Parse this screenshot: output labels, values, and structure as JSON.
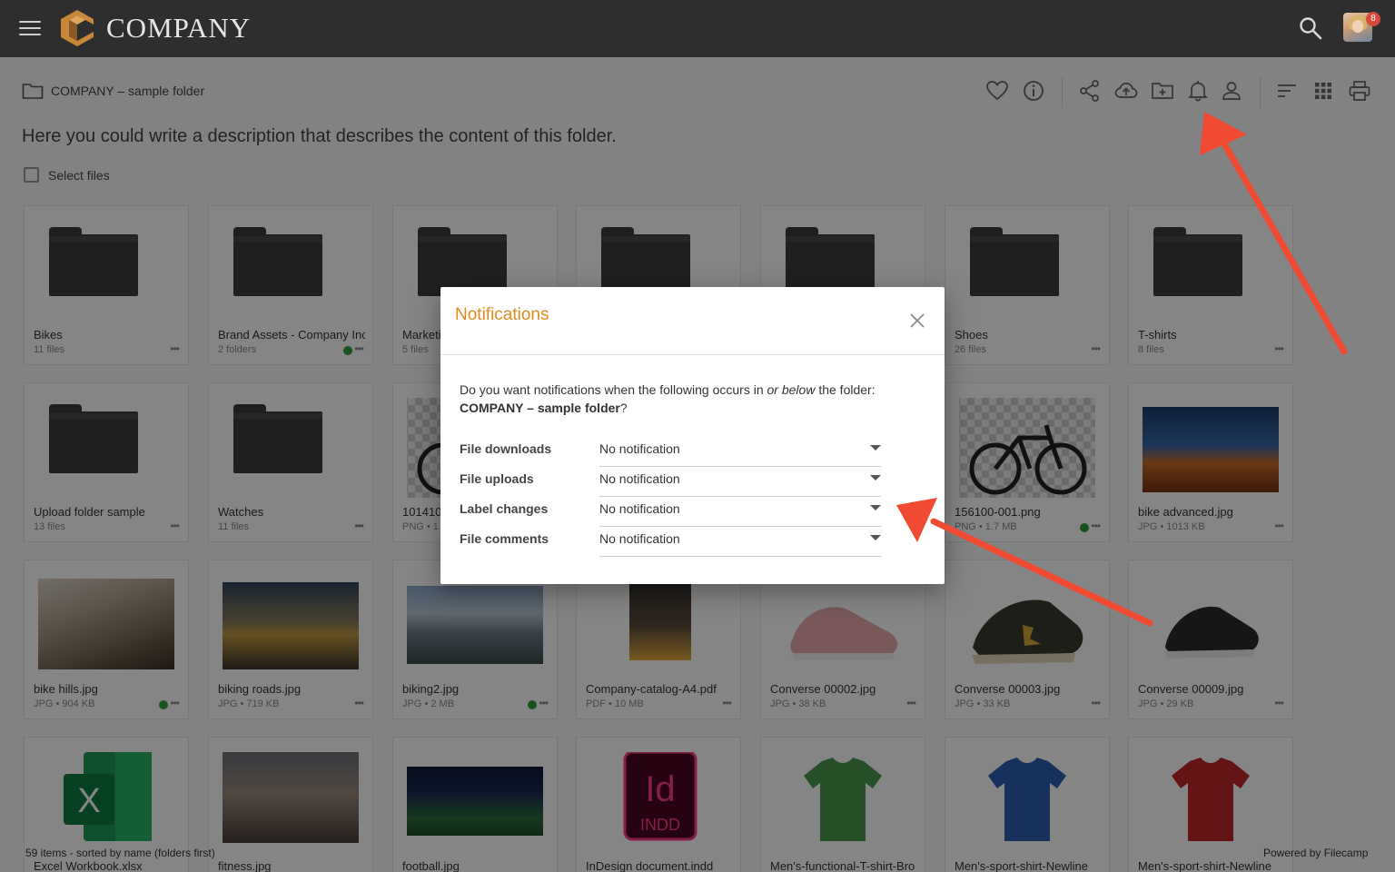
{
  "app": {
    "brand": "COMPANY",
    "notification_count": "8"
  },
  "breadcrumb": {
    "path": "COMPANY – sample folder"
  },
  "description": "Here you could write a description that describes the content of this folder.",
  "select_files_label": "Select files",
  "tiles": [
    {
      "name": "Bikes",
      "meta": "11 files",
      "kind": "folder",
      "dot": false
    },
    {
      "name": "Brand Assets - Company Inc",
      "meta": "2 folders",
      "kind": "folder",
      "dot": true
    },
    {
      "name": "Marketi",
      "meta": "5 files",
      "kind": "folder",
      "dot": false
    },
    {
      "name": "",
      "meta": "",
      "kind": "folder",
      "dot": false
    },
    {
      "name": "",
      "meta": "",
      "kind": "folder",
      "dot": false
    },
    {
      "name": "Shoes",
      "meta": "26 files",
      "kind": "folder",
      "dot": false
    },
    {
      "name": "T-shirts",
      "meta": "8 files",
      "kind": "folder",
      "dot": false
    },
    {
      "name": "Upload folder sample",
      "meta": "13 files",
      "kind": "folder",
      "dot": false
    },
    {
      "name": "Watches",
      "meta": "11 files",
      "kind": "folder",
      "dot": false
    },
    {
      "name": "101410",
      "meta": "PNG • 1",
      "kind": "bike-checker",
      "dot": false
    },
    {
      "name": "",
      "meta": "",
      "kind": "blank",
      "dot": false
    },
    {
      "name": "",
      "meta": "",
      "kind": "blank",
      "dot": false
    },
    {
      "name": "156100-001.png",
      "meta": "PNG • 1.7 MB",
      "kind": "bike-checker",
      "dot": true
    },
    {
      "name": "bike advanced.jpg",
      "meta": "JPG • 1013 KB",
      "kind": "photo-desert",
      "dot": false
    },
    {
      "name": "bike hills.jpg",
      "meta": "JPG • 904 KB",
      "kind": "photo-hills",
      "dot": true
    },
    {
      "name": "biking roads.jpg",
      "meta": "JPG • 719 KB",
      "kind": "photo-road",
      "dot": false
    },
    {
      "name": "biking2.jpg",
      "meta": "JPG • 2 MB",
      "kind": "photo-coast",
      "dot": true
    },
    {
      "name": "Company-catalog-A4.pdf",
      "meta": "PDF • 10 MB",
      "kind": "pdf",
      "dot": false
    },
    {
      "name": "Converse 00002.jpg",
      "meta": "JPG • 38 KB",
      "kind": "shoe-pink",
      "dot": false
    },
    {
      "name": "Converse 00003.jpg",
      "meta": "JPG • 33 KB",
      "kind": "shoe-dark",
      "dot": false
    },
    {
      "name": "Converse 00009.jpg",
      "meta": "JPG • 29 KB",
      "kind": "shoe-black",
      "dot": false
    },
    {
      "name": "Excel Workbook.xlsx",
      "meta": "",
      "kind": "excel",
      "dot": false
    },
    {
      "name": "fitness.jpg",
      "meta": "",
      "kind": "photo-gym",
      "dot": false
    },
    {
      "name": "football.jpg",
      "meta": "",
      "kind": "photo-stadium",
      "dot": false
    },
    {
      "name": "InDesign document.indd",
      "meta": "",
      "kind": "indd",
      "dot": false
    },
    {
      "name": "Men's-functional-T-shirt-Bro",
      "meta": "",
      "kind": "shirt-green",
      "dot": false
    },
    {
      "name": "Men's-sport-shirt-Newline",
      "meta": "",
      "kind": "shirt-blue",
      "dot": false
    },
    {
      "name": "Men's-sport-shirt-Newline",
      "meta": "",
      "kind": "shirt-red",
      "dot": false
    }
  ],
  "status": {
    "left": "59 items - sorted by name (folders first)",
    "right": "Powered by Filecamp"
  },
  "modal": {
    "title": "Notifications",
    "question_pre": "Do you want notifications when the following occurs in ",
    "question_em": "or below",
    "question_post": " the folder:",
    "folder_name": "COMPANY – sample folder",
    "folder_suffix": "?",
    "rows": [
      {
        "label": "File downloads",
        "value": "No notification"
      },
      {
        "label": "File uploads",
        "value": "No notification"
      },
      {
        "label": "Label changes",
        "value": "No notification"
      },
      {
        "label": "File comments",
        "value": "No notification"
      }
    ]
  },
  "colors": {
    "accent": "#e08a1e",
    "topbar": "#2e2e2e",
    "arrow": "#f04a32",
    "badge": "#d84a3c",
    "status_dot": "#2e9e3a"
  }
}
